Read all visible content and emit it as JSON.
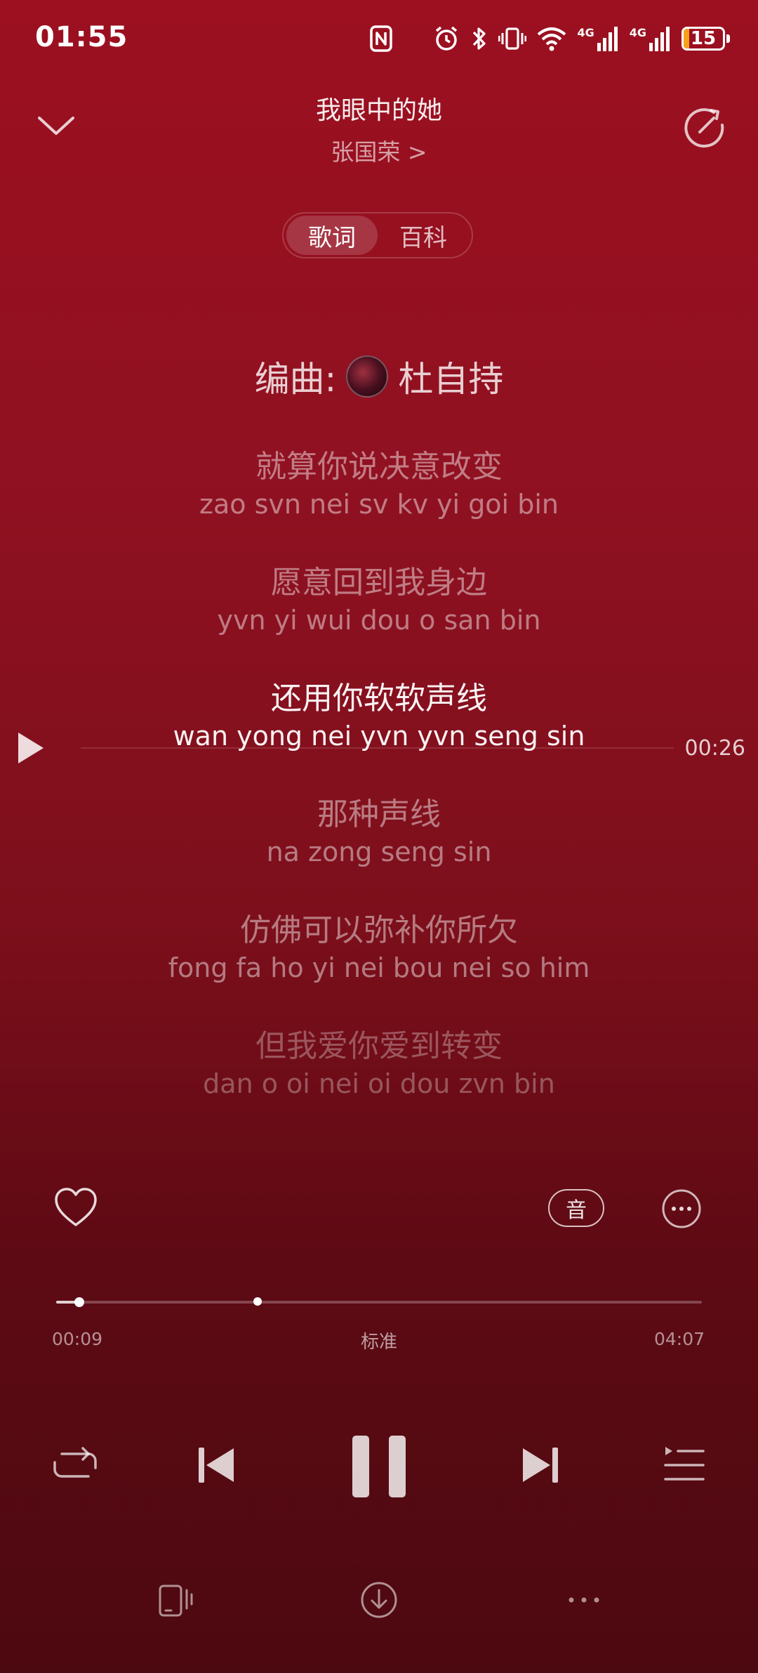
{
  "status_bar": {
    "time": "01:55",
    "battery": "15",
    "battery_percent": 15,
    "network_1": "4G",
    "network_2": "4G",
    "icons": [
      "nfc-icon",
      "alarm-icon",
      "bluetooth-icon",
      "vibrate-icon",
      "wifi-icon",
      "signal-icon",
      "battery-icon"
    ]
  },
  "header": {
    "song_title": "我眼中的她",
    "artist": "张国荣 >"
  },
  "tabs": [
    {
      "label": "歌词",
      "active": true
    },
    {
      "label": "百科",
      "active": false
    }
  ],
  "lyrics": {
    "credit_label": "编曲:",
    "credit_name": "杜自持",
    "lines": [
      {
        "zh": "就算你说决意改变",
        "py": "zao svn nei sv kv yi goi bin"
      },
      {
        "zh": "愿意回到我身边",
        "py": "yvn yi wui dou o san bin"
      },
      {
        "zh": "还用你软软声线",
        "py": "wan yong nei yvn yvn seng sin"
      },
      {
        "zh": "那种声线",
        "py": "na zong seng sin"
      },
      {
        "zh": "仿佛可以弥补你所欠",
        "py": "fong fa ho yi nei bou nei so him"
      },
      {
        "zh": "但我爱你爱到转变",
        "py": "dan o oi nei oi dou zvn bin"
      }
    ],
    "seek_time": "00:26"
  },
  "actions": {
    "sound_label": "音"
  },
  "progress": {
    "current": "00:09",
    "total": "04:07",
    "quality": "标准",
    "played_fraction": 0.036
  },
  "colors": {
    "background_top": "#9c1020",
    "background_bottom": "#4d0910",
    "battery_fill": "#f7a21b"
  }
}
